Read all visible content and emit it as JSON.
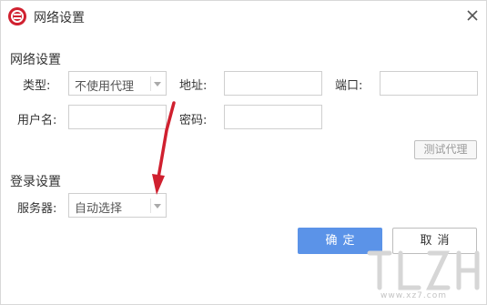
{
  "window": {
    "title": "网络设置",
    "close_icon": "close-icon",
    "logo_icon": "app-logo-icon",
    "brand_color": "#d0202f"
  },
  "network": {
    "section_title": "网络设置",
    "type_label": "类型:",
    "type_value": "不使用代理",
    "address_label": "地址:",
    "address_value": "",
    "port_label": "端口:",
    "port_value": "",
    "username_label": "用户名:",
    "username_value": "",
    "password_label": "密码:",
    "password_value": "",
    "test_proxy_button": "测试代理"
  },
  "login": {
    "section_title": "登录设置",
    "server_label": "服务器:",
    "server_value": "自动选择"
  },
  "footer": {
    "ok_button": "确定",
    "cancel_button": "取消",
    "ok_color": "#5b93e8"
  },
  "annotation": {
    "arrow_color": "#d0202f"
  },
  "watermark": {
    "url": "www.xz7.com"
  }
}
